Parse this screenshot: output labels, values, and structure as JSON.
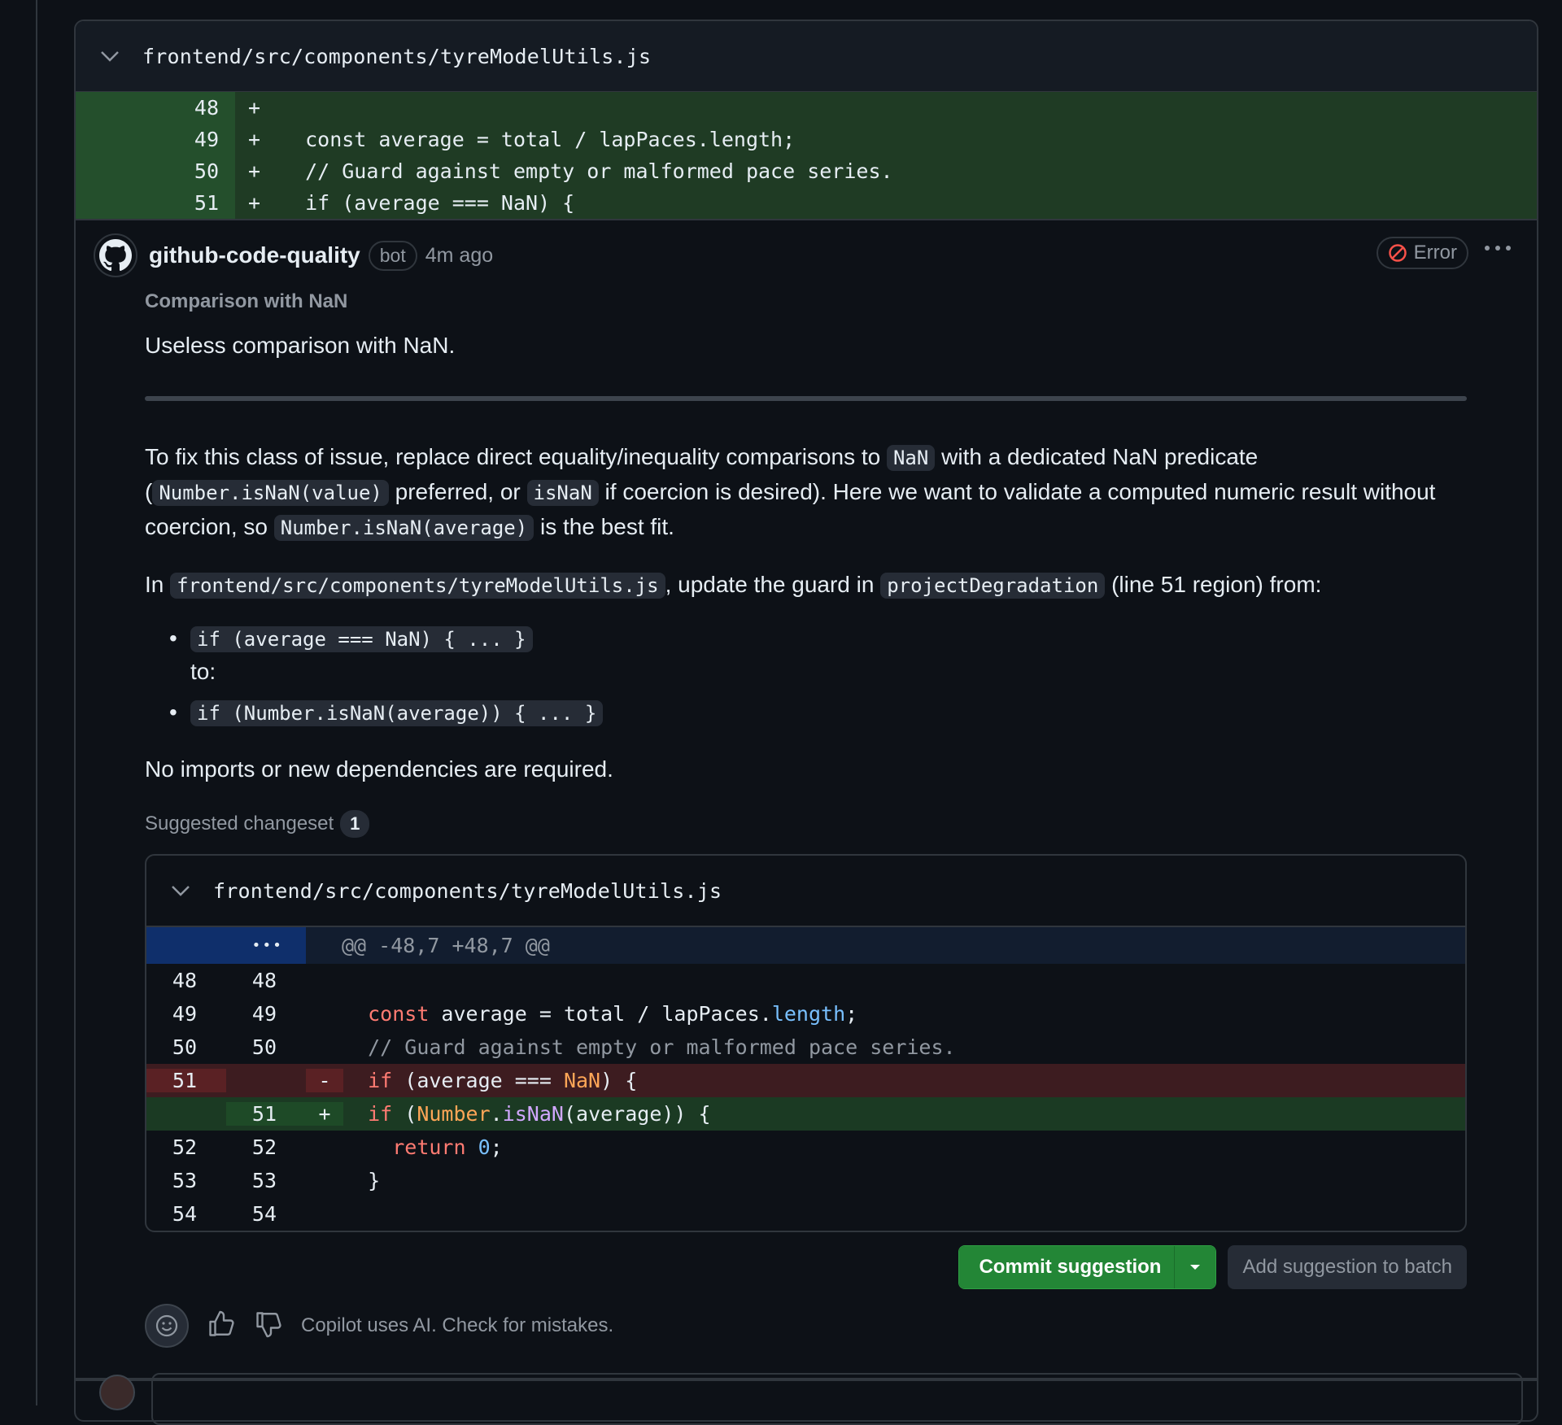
{
  "file": {
    "path": "frontend/src/components/tyreModelUtils.js",
    "context_lines": [
      {
        "num": "48",
        "sign": "+",
        "code": ""
      },
      {
        "num": "49",
        "sign": "+",
        "code": "  const average = total / lapPaces.length;"
      },
      {
        "num": "50",
        "sign": "+",
        "code": "  // Guard against empty or malformed pace series."
      },
      {
        "num": "51",
        "sign": "+",
        "code": "  if (average === NaN) {"
      }
    ]
  },
  "comment": {
    "author": "github-code-quality",
    "badge": "bot",
    "time": "4m ago",
    "status": "Error",
    "rule_title": "Comparison with NaN",
    "summary": "Useless comparison with NaN.",
    "para1": {
      "t1": "To fix this class of issue, replace direct equality/inequality comparisons to ",
      "c1": "NaN",
      "t2": " with a dedicated NaN predicate (",
      "c2": "Number.isNaN(value)",
      "t3": " preferred, or ",
      "c3": "isNaN",
      "t4": " if coercion is desired). Here we want to validate a computed numeric result without coercion, so ",
      "c4": "Number.isNaN(average)",
      "t5": " is the best fit."
    },
    "para2": {
      "t1": "In ",
      "c1": "frontend/src/components/tyreModelUtils.js",
      "t2": ", update the guard in ",
      "c2": "projectDegradation",
      "t3": " (line 51 region) from:"
    },
    "step_from": "if (average === NaN) { ... }",
    "step_to_label": "to:",
    "step_to": "if (Number.isNaN(average)) { ... }",
    "para3": "No imports or new dependencies are required.",
    "changeset_label": "Suggested changeset",
    "changeset_count": "1"
  },
  "suggestion": {
    "path": "frontend/src/components/tyreModelUtils.js",
    "hunk_dots": "•••",
    "hunk": "@@ -48,7 +48,7 @@",
    "rows": {
      "r48": {
        "old": "48",
        "new": "48"
      },
      "r49": {
        "old": "49",
        "new": "49",
        "kw": "const",
        "rest1": " average = total / lapPaces.",
        "prop": "length",
        "rest2": ";"
      },
      "r50": {
        "old": "50",
        "new": "50",
        "comment": "// Guard against empty or malformed pace series."
      },
      "rdel": {
        "old": "51",
        "sign": "-",
        "kw": "if",
        "rest1": " (average === ",
        "const": "NaN",
        "rest2": ") {"
      },
      "radd": {
        "new": "51",
        "sign": "+",
        "kw": "if",
        "rest1": " (",
        "obj": "Number",
        "dot": ".",
        "fn": "isNaN",
        "rest2": "(average)) {"
      },
      "r52": {
        "old": "52",
        "new": "52",
        "kw": "return",
        "sp": " ",
        "num": "0",
        "rest": ";"
      },
      "r53": {
        "old": "53",
        "new": "53",
        "code": "}"
      },
      "r54": {
        "old": "54",
        "new": "54"
      }
    }
  },
  "actions": {
    "commit": "Commit suggestion",
    "batch": "Add suggestion to batch"
  },
  "footer": {
    "disclaimer": "Copilot uses AI. Check for mistakes."
  },
  "colors": {
    "accent_green": "#238636",
    "error": "#f85149"
  }
}
